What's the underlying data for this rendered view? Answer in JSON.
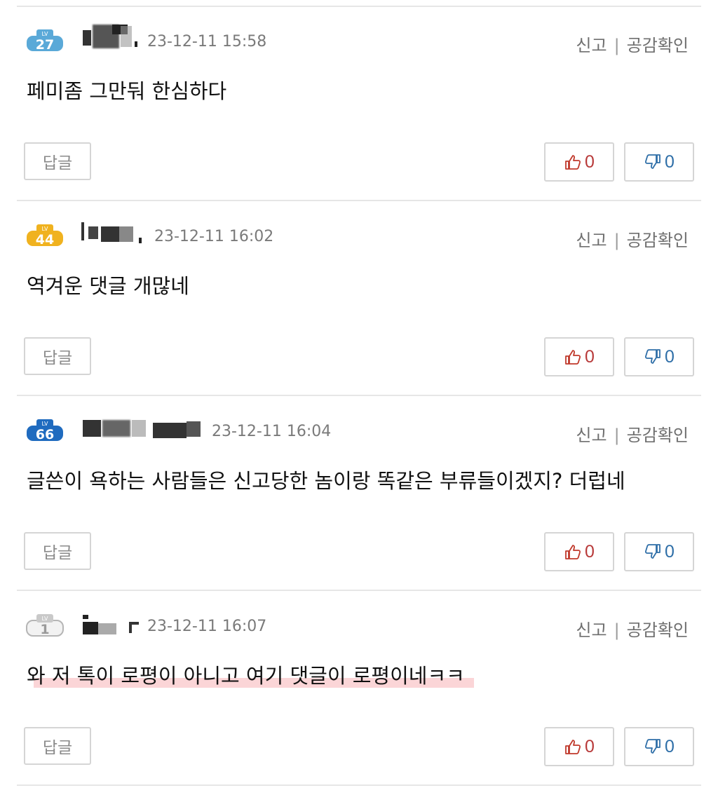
{
  "labels": {
    "report": "신고",
    "separator": "|",
    "empathy_check": "공감확인",
    "reply": "답글",
    "level_prefix": "LV"
  },
  "colors": {
    "upvote": "#b83a3a",
    "downvote": "#2f6fa8",
    "highlight": "#fbd0d3"
  },
  "comments": [
    {
      "level": "27",
      "badge_color": "#5aa9d8",
      "date": "23-12-11 15:58",
      "text": "페미좀 그만둬 한심하다",
      "likes": "0",
      "dislikes": "0",
      "highlighted": false
    },
    {
      "level": "44",
      "badge_color": "#f0b21f",
      "date": "23-12-11 16:02",
      "text": "역겨운 댓글 개많네",
      "likes": "0",
      "dislikes": "0",
      "highlighted": false
    },
    {
      "level": "66",
      "badge_color": "#1f6bbf",
      "date": "23-12-11 16:04",
      "text": "글쓴이 욕하는 사람들은 신고당한 놈이랑 똑같은 부류들이겠지? 더럽네",
      "likes": "0",
      "dislikes": "0",
      "highlighted": false
    },
    {
      "level": "1",
      "badge_color": "#c9c9c9",
      "date": "23-12-11 16:07",
      "text": "와 저 톡이 로평이 아니고 여기 댓글이 로평이네ㅋㅋ",
      "likes": "0",
      "dislikes": "0",
      "highlighted": true
    }
  ]
}
